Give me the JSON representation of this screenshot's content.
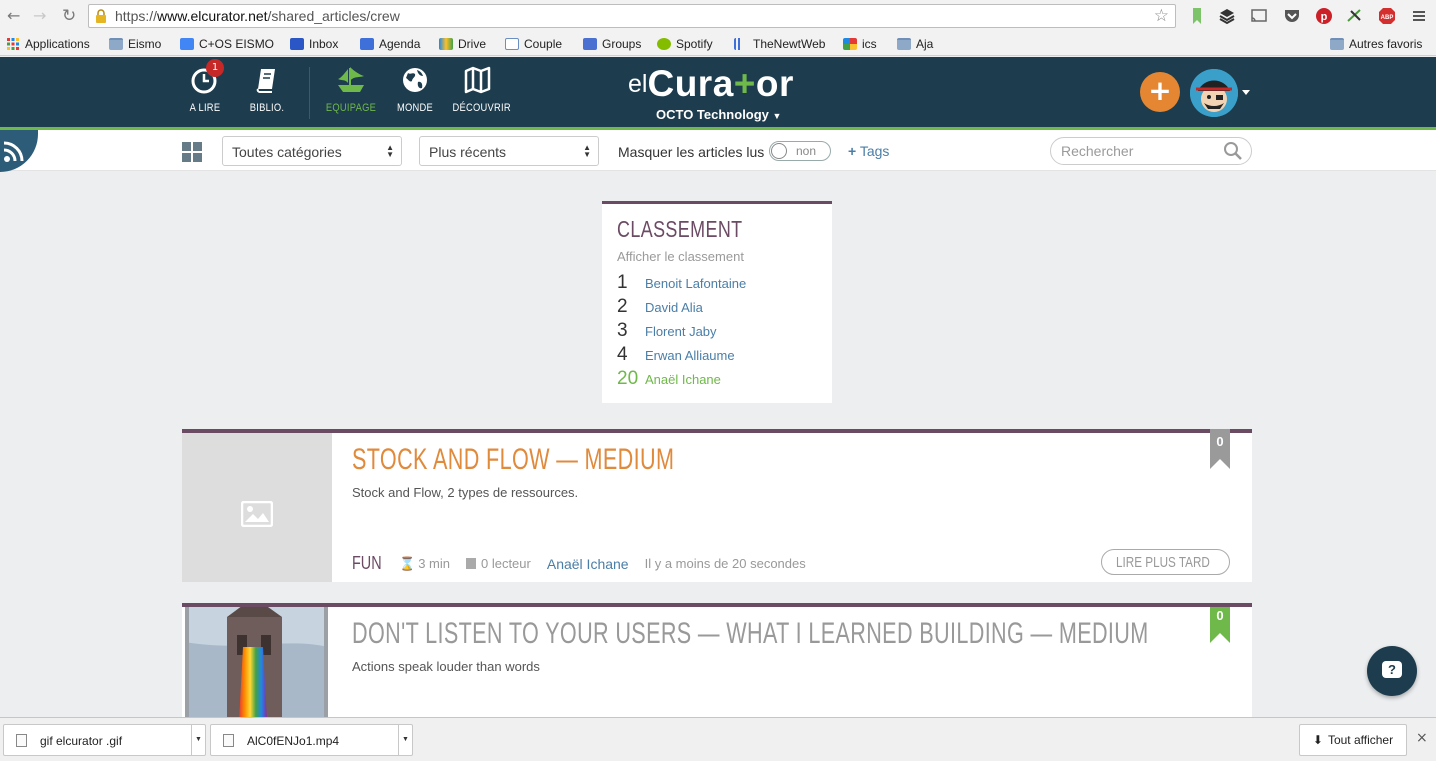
{
  "browser": {
    "url_prefix": "https://",
    "url_domain": "www.elcurator.net",
    "url_path": "/shared_articles/crew",
    "bookmarks": [
      {
        "label": "Applications",
        "icon": "apps-grid-icon"
      },
      {
        "label": "Eismo",
        "icon": "folder-icon"
      },
      {
        "label": "C+OS EISMO",
        "icon": "google-icon"
      },
      {
        "label": "Inbox",
        "icon": "inbox-icon"
      },
      {
        "label": "Agenda",
        "icon": "calendar-icon"
      },
      {
        "label": "Drive",
        "icon": "drive-icon"
      },
      {
        "label": "Couple",
        "icon": "heart-icon"
      },
      {
        "label": "Groups",
        "icon": "groups-icon"
      },
      {
        "label": "Spotify",
        "icon": "spotify-icon"
      },
      {
        "label": "TheNewtWeb",
        "icon": "bars-icon"
      },
      {
        "label": "ics",
        "icon": "ics-icon"
      },
      {
        "label": "Aja",
        "icon": "folder-icon"
      }
    ],
    "other_bookmarks": "Autres favoris"
  },
  "header": {
    "nav": [
      {
        "label": "A LIRE",
        "badge": "1"
      },
      {
        "label": "BIBLIO."
      },
      {
        "label": "EQUIPAGE"
      },
      {
        "label": "MONDE"
      },
      {
        "label": "DÉCOUVRIR"
      }
    ],
    "brand_el": "el",
    "brand_cura": "Cura",
    "brand_plus": "+",
    "brand_or": "or",
    "company": "OCTO Technology",
    "add_label": "+"
  },
  "filters": {
    "category": "Toutes catégories",
    "sort": "Plus récents",
    "mask_label": "Masquer les articles lus",
    "toggle_label": "non",
    "tags_label": "Tags",
    "search_placeholder": "Rechercher"
  },
  "ranking": {
    "title": "CLASSEMENT",
    "subtitle": "Afficher le classement",
    "rows": [
      {
        "rank": "1",
        "name": "Benoit Lafontaine"
      },
      {
        "rank": "2",
        "name": "David Alia"
      },
      {
        "rank": "3",
        "name": "Florent Jaby"
      },
      {
        "rank": "4",
        "name": "Erwan Alliaume"
      },
      {
        "rank": "20",
        "name": "Anaël Ichane"
      }
    ]
  },
  "articles": [
    {
      "title": "STOCK AND FLOW — MEDIUM",
      "description": "Stock and Flow, 2 types de ressources.",
      "category": "FUN",
      "read_time": "3 min",
      "readers": "0 lecteur",
      "author": "Anaël Ichane",
      "time_ago": "Il y a moins de 20 secondes",
      "read_later": "LIRE PLUS TARD",
      "count": "0",
      "title_color": "#e08a3c",
      "flag_color": "#9a9a9a"
    },
    {
      "title": "DON'T LISTEN TO YOUR USERS — WHAT I LEARNED BUILDING — MEDIUM",
      "description": "Actions speak louder than words",
      "count": "0",
      "title_color": "#999999",
      "flag_color": "#6fb84a"
    }
  ],
  "help_label": "?",
  "downloads": {
    "items": [
      {
        "name": "gif elcurator .gif"
      },
      {
        "name": "AlC0fENJo1.mp4"
      }
    ],
    "show_all": "Tout afficher",
    "close": "×"
  },
  "colors": {
    "header_bg": "#1d3c4d",
    "accent_green": "#6fb84a",
    "accent_orange": "#e58732",
    "accent_purple": "#6b4a63",
    "link_blue": "#4a7ea7"
  }
}
